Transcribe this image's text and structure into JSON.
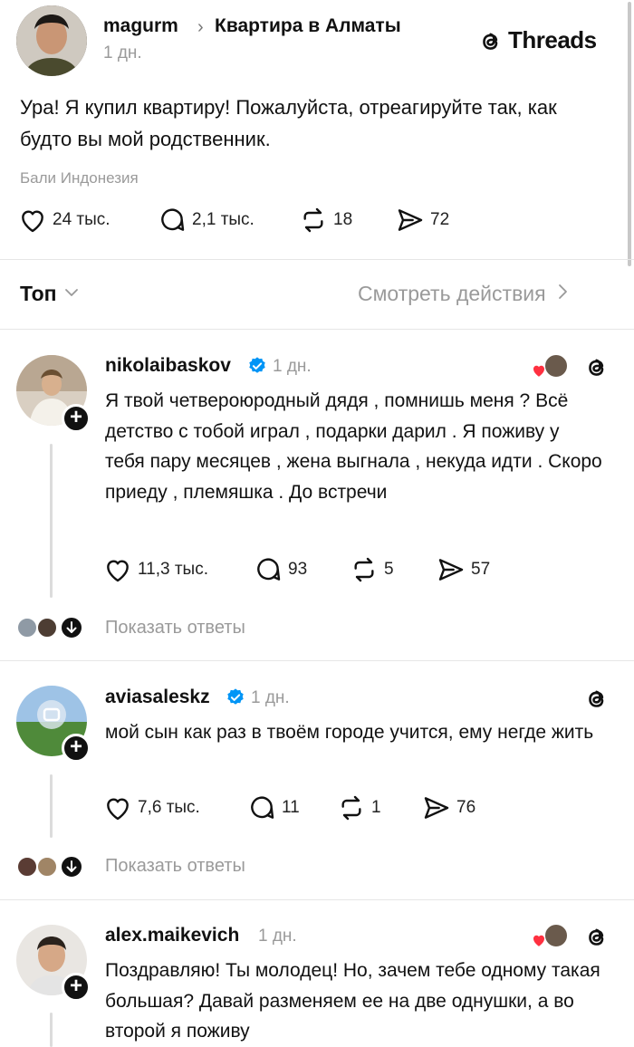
{
  "post": {
    "author": "magurm",
    "community": "Квартира в Алматы",
    "time": "1 дн.",
    "brand": "Threads",
    "text": "Ура! Я купил квартиру! Пожалуйста, отреагируйте так, как будто вы мой родственник.",
    "location": "Бали Индонезия",
    "likes": "24 тыс.",
    "comments": "2,1 тыс.",
    "reposts": "18",
    "shares": "72"
  },
  "sort": {
    "label": "Топ",
    "activity_link": "Смотреть действия"
  },
  "replies": [
    {
      "author": "nikolaibaskov",
      "verified": true,
      "time": "1 дн.",
      "text": "Я твой четвероюродный дядя , помнишь меня ? Всё детство с тобой играл , подарки дарил . Я поживу у тебя пару месяцев , жена выгнала , некуда идти . Скоро приеду , племяшка . До встречи",
      "likes": "11,3 тыс.",
      "comments": "93",
      "reposts": "5",
      "shares": "57",
      "show_replies": "Показать ответы"
    },
    {
      "author": "aviasaleskz",
      "verified": true,
      "time": "1 дн.",
      "text": "мой сын как раз в твоём городе учится, ему негде жить",
      "likes": "7,6 тыс.",
      "comments": "11",
      "reposts": "1",
      "shares": "76",
      "show_replies": "Показать ответы"
    },
    {
      "author": "alex.maikevich",
      "verified": false,
      "time": "1 дн.",
      "text": "Поздравляю! Ты молодец! Но, зачем тебе одному такая большая? Давай разменяем ее на две однушки, а во второй я поживу"
    }
  ],
  "colors": {
    "verified": "#0095f6",
    "heart": "#ff3040",
    "muted": "#9a9a9a"
  }
}
